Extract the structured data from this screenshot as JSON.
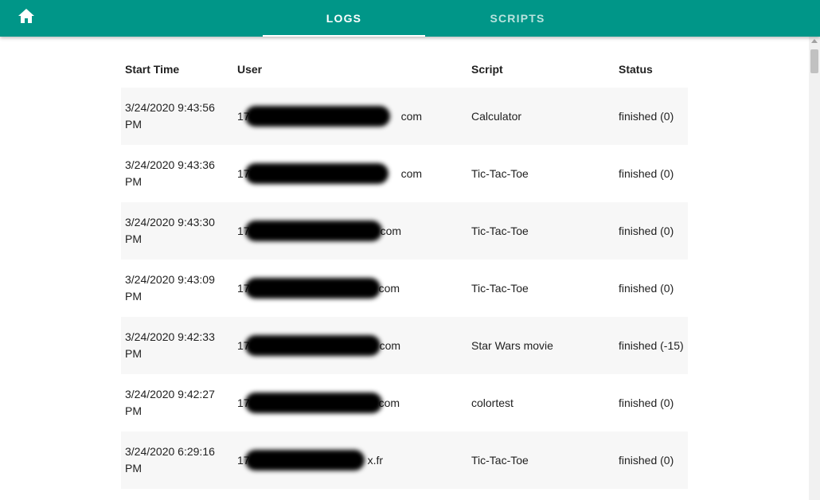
{
  "appbar": {
    "home_icon": "home-icon",
    "tabs": [
      {
        "label": "LOGS",
        "active": true
      },
      {
        "label": "SCRIPTS",
        "active": false
      }
    ],
    "colors": {
      "primary": "#009688",
      "active_tab": "#ffffff",
      "inactive_tab": "#b9e3de"
    }
  },
  "table": {
    "headers": {
      "start_time": "Start Time",
      "user": "User",
      "script": "Script",
      "status": "Status"
    },
    "rows": [
      {
        "start_time": "3/24/2020 9:43:56 PM",
        "user_prefix": "17",
        "user_suffix": "com",
        "script": "Calculator",
        "status": "finished (0)"
      },
      {
        "start_time": "3/24/2020 9:43:36 PM",
        "user_prefix": "17",
        "user_suffix": "com",
        "script": "Tic-Tac-Toe",
        "status": "finished (0)"
      },
      {
        "start_time": "3/24/2020 9:43:30 PM",
        "user_prefix": "17",
        "user_suffix": "com",
        "script": "Tic-Tac-Toe",
        "status": "finished (0)"
      },
      {
        "start_time": "3/24/2020 9:43:09 PM",
        "user_prefix": "17",
        "user_suffix": "com",
        "script": "Tic-Tac-Toe",
        "status": "finished (0)"
      },
      {
        "start_time": "3/24/2020 9:42:33 PM",
        "user_prefix": "17",
        "user_suffix": "com",
        "script": "Star Wars movie",
        "status": "finished (-15)"
      },
      {
        "start_time": "3/24/2020 9:42:27 PM",
        "user_prefix": "17",
        "user_suffix": "com",
        "script": "colortest",
        "status": "finished (0)"
      },
      {
        "start_time": "3/24/2020 6:29:16 PM",
        "user_prefix": "17",
        "user_suffix": "x.fr",
        "script": "Tic-Tac-Toe",
        "status": "finished (0)"
      }
    ]
  }
}
